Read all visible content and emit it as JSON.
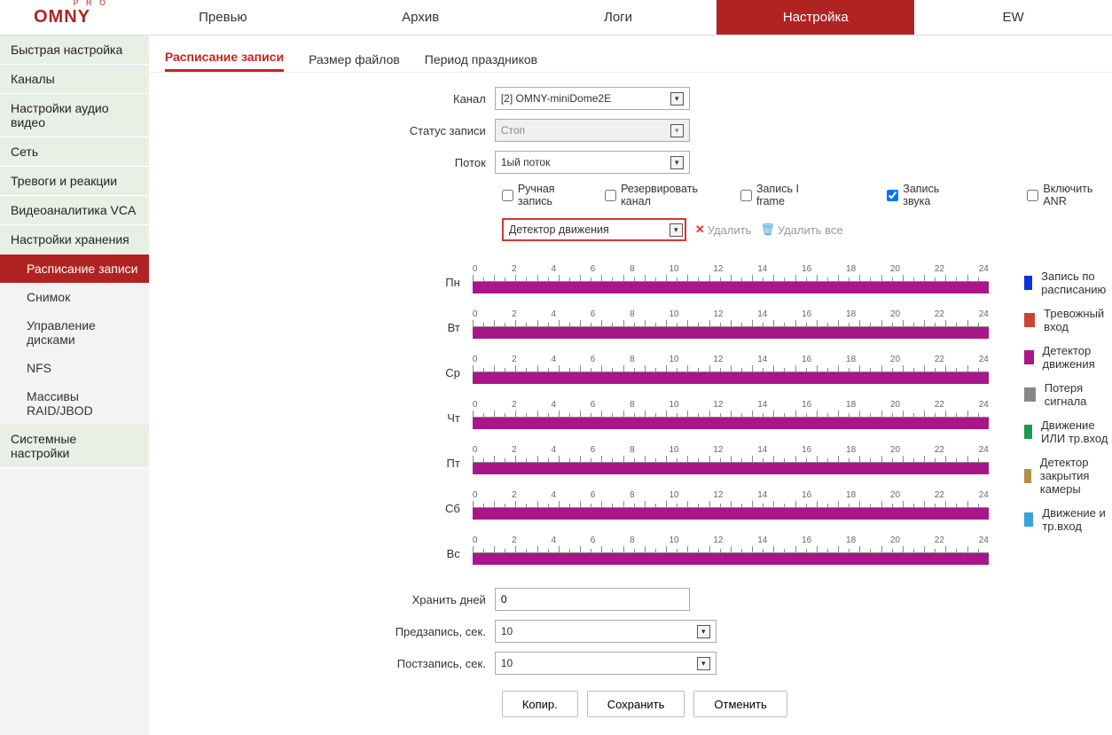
{
  "logo": {
    "main": "OMNY",
    "pro": "P R O"
  },
  "topnav": {
    "items": [
      "Превью",
      "Архив",
      "Логи",
      "Настройка",
      "EW"
    ],
    "active_index": 3
  },
  "sidebar": [
    {
      "label": "Быстрая настройка",
      "level": 0
    },
    {
      "label": "Каналы",
      "level": 0
    },
    {
      "label": "Настройки аудио видео",
      "level": 0
    },
    {
      "label": "Сеть",
      "level": 0
    },
    {
      "label": "Тревоги и реакции",
      "level": 0
    },
    {
      "label": "Видеоаналитика VCA",
      "level": 0
    },
    {
      "label": "Настройки хранения",
      "level": 0
    },
    {
      "label": "Расписание записи",
      "level": 1,
      "active": true
    },
    {
      "label": "Снимок",
      "level": 1
    },
    {
      "label": "Управление дисками",
      "level": 1
    },
    {
      "label": "NFS",
      "level": 1
    },
    {
      "label": "Массивы RAID/JBOD",
      "level": 1
    },
    {
      "label": "Системные настройки",
      "level": 0
    }
  ],
  "subtabs": {
    "items": [
      "Расписание записи",
      "Размер файлов",
      "Период праздников"
    ],
    "active_index": 0
  },
  "form": {
    "channel_label": "Канал",
    "channel_value": "[2] OMNY-miniDome2E",
    "status_label": "Статус записи",
    "status_value": "Стоп",
    "stream_label": "Поток",
    "stream_value": "1ый поток"
  },
  "checkboxes": {
    "manual": {
      "label": "Ручная запись",
      "checked": false
    },
    "reserve": {
      "label": "Резервировать канал",
      "checked": false
    },
    "iframe": {
      "label": "Запись I frame",
      "checked": false
    },
    "audio": {
      "label": "Запись звука",
      "checked": true
    },
    "anr": {
      "label": "Включить ANR",
      "checked": false
    }
  },
  "event_type": "Детектор движения",
  "delete_label": "Удалить",
  "delete_all_label": "Удалить все",
  "schedule": {
    "ticks": [
      "0",
      "2",
      "4",
      "6",
      "8",
      "10",
      "12",
      "14",
      "16",
      "18",
      "20",
      "22",
      "24"
    ],
    "days": [
      "Пн",
      "Вт",
      "Ср",
      "Чт",
      "Пт",
      "Сб",
      "Вс"
    ],
    "bar_color": "#a8168a"
  },
  "legend": [
    {
      "color": "#1133dd",
      "label": "Запись по расписанию"
    },
    {
      "color": "#cc4433",
      "label": "Тревожный вход"
    },
    {
      "color": "#a8168a",
      "label": "Детектор движения"
    },
    {
      "color": "#888888",
      "label": "Потеря сигнала"
    },
    {
      "color": "#1a9c4c",
      "label": "Движение ИЛИ тр.вход"
    },
    {
      "color": "#b0913e",
      "label": "Детектор закрытия камеры"
    },
    {
      "color": "#3aa0d8",
      "label": "Движение и тр.вход"
    }
  ],
  "bottom": {
    "keep_label": "Хранить дней",
    "keep_value": "0",
    "pre_label": "Предзапись, сек.",
    "pre_value": "10",
    "post_label": "Постзапись, сек.",
    "post_value": "10"
  },
  "buttons": {
    "copy": "Копир.",
    "save": "Сохранить",
    "cancel": "Отменить"
  }
}
